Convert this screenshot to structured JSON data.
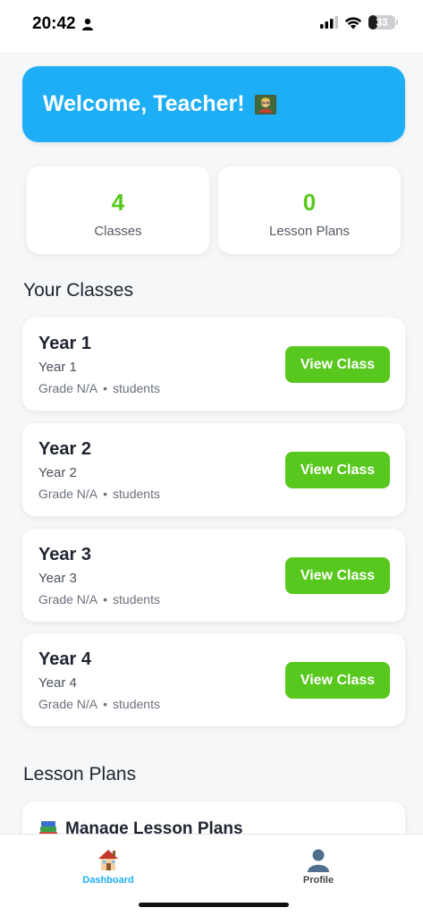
{
  "status_bar": {
    "time": "20:42",
    "battery": "33",
    "battery_level": 0.33
  },
  "welcome": {
    "title": "Welcome, Teacher!"
  },
  "stats": [
    {
      "value": "4",
      "label": "Classes"
    },
    {
      "value": "0",
      "label": "Lesson Plans"
    }
  ],
  "sections": {
    "classes_title": "Your Classes",
    "lessons_title": "Lesson Plans"
  },
  "classes": [
    {
      "name": "Year 1",
      "subtitle": "Year 1",
      "grade": "Grade N/A",
      "bullet": "•",
      "students": "students",
      "button": "View Class"
    },
    {
      "name": "Year 2",
      "subtitle": "Year 2",
      "grade": "Grade N/A",
      "bullet": "•",
      "students": "students",
      "button": "View Class"
    },
    {
      "name": "Year 3",
      "subtitle": "Year 3",
      "grade": "Grade N/A",
      "bullet": "•",
      "students": "students",
      "button": "View Class"
    },
    {
      "name": "Year 4",
      "subtitle": "Year 4",
      "grade": "Grade N/A",
      "bullet": "•",
      "students": "students",
      "button": "View Class"
    }
  ],
  "lesson_card": {
    "title": "Manage Lesson Plans"
  },
  "tabs": [
    {
      "label": "Dashboard",
      "icon": "house-icon",
      "active": true
    },
    {
      "label": "Profile",
      "icon": "person-silhouette-icon",
      "active": false
    }
  ],
  "colors": {
    "primary_blue": "#1daef5",
    "accent_green": "#58c81e",
    "background": "#f6f7f9"
  }
}
